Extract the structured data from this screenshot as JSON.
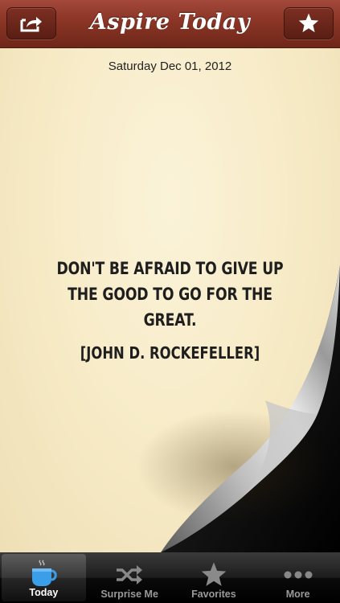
{
  "header": {
    "title": "Aspire Today",
    "share_icon": "share-icon",
    "favorite_icon": "star-icon"
  },
  "page": {
    "date": "Saturday Dec 01, 2012",
    "quote": "DON'T BE AFRAID TO GIVE UP THE GOOD TO GO FOR THE GREAT.",
    "author": "[JOHN D. ROCKEFELLER]"
  },
  "tabs": [
    {
      "label": "Today",
      "icon": "coffee-cup-icon",
      "active": true
    },
    {
      "label": "Surprise Me",
      "icon": "shuffle-icon",
      "active": false
    },
    {
      "label": "Favorites",
      "icon": "star-icon",
      "active": false
    },
    {
      "label": "More",
      "icon": "more-dots-icon",
      "active": false
    }
  ],
  "colors": {
    "header": "#8a3526",
    "paper": "#f7ebc7",
    "active_tab_icon": "#3a9ee8"
  }
}
